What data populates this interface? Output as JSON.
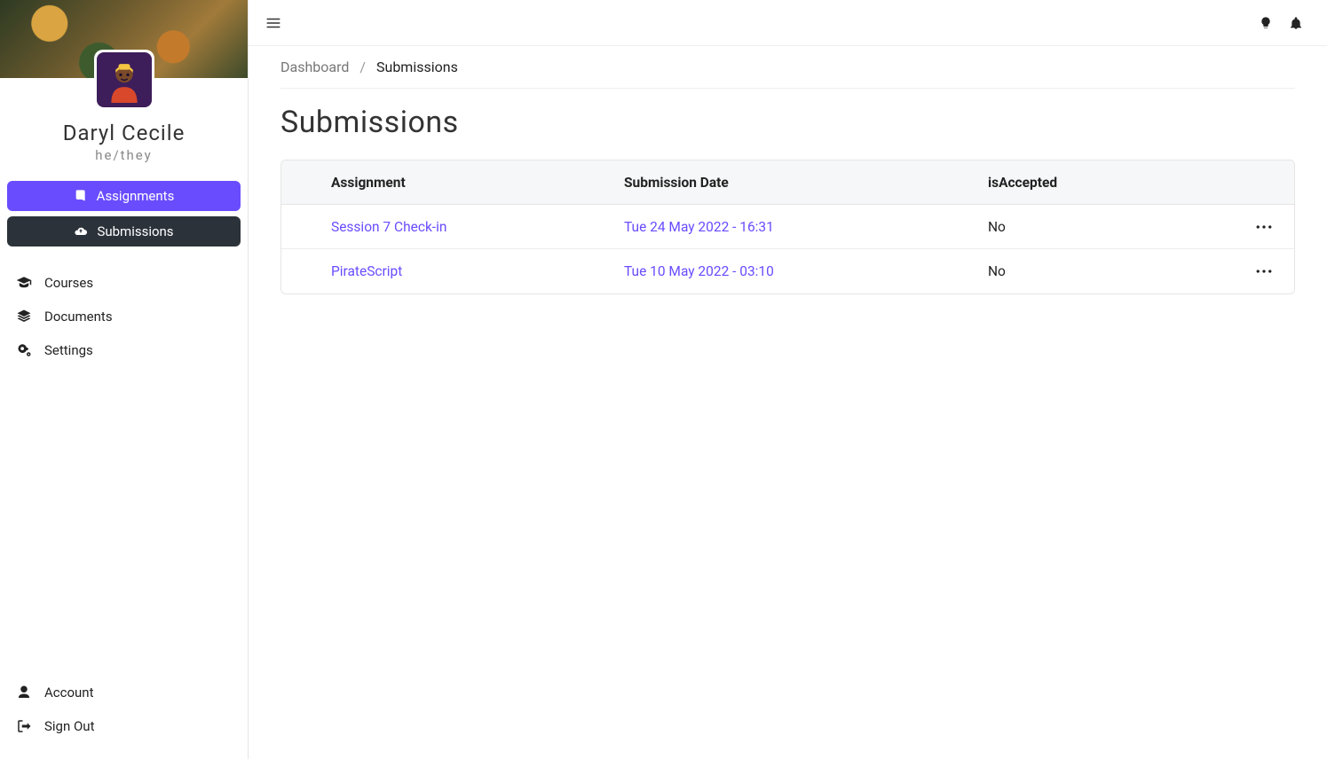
{
  "profile": {
    "name": "Daryl Cecile",
    "pronouns": "he/they"
  },
  "sidebar": {
    "pills": {
      "assignments": "Assignments",
      "submissions": "Submissions"
    },
    "links": {
      "courses": "Courses",
      "documents": "Documents",
      "settings": "Settings"
    },
    "bottom": {
      "account": "Account",
      "signout": "Sign Out"
    }
  },
  "breadcrumb": {
    "root": "Dashboard",
    "sep": "/",
    "current": "Submissions"
  },
  "page": {
    "title": "Submissions"
  },
  "table": {
    "headers": {
      "assignment": "Assignment",
      "date": "Submission Date",
      "accepted": "isAccepted"
    },
    "rows": [
      {
        "status_color": "#6fcf7f",
        "assignment": "Session 7 Check-in",
        "date": "Tue 24 May 2022 - 16:31",
        "accepted": "No"
      },
      {
        "status_color": "#6fcf7f",
        "assignment": "PirateScript",
        "date": "Tue 10 May 2022 - 03:10",
        "accepted": "No"
      }
    ]
  }
}
